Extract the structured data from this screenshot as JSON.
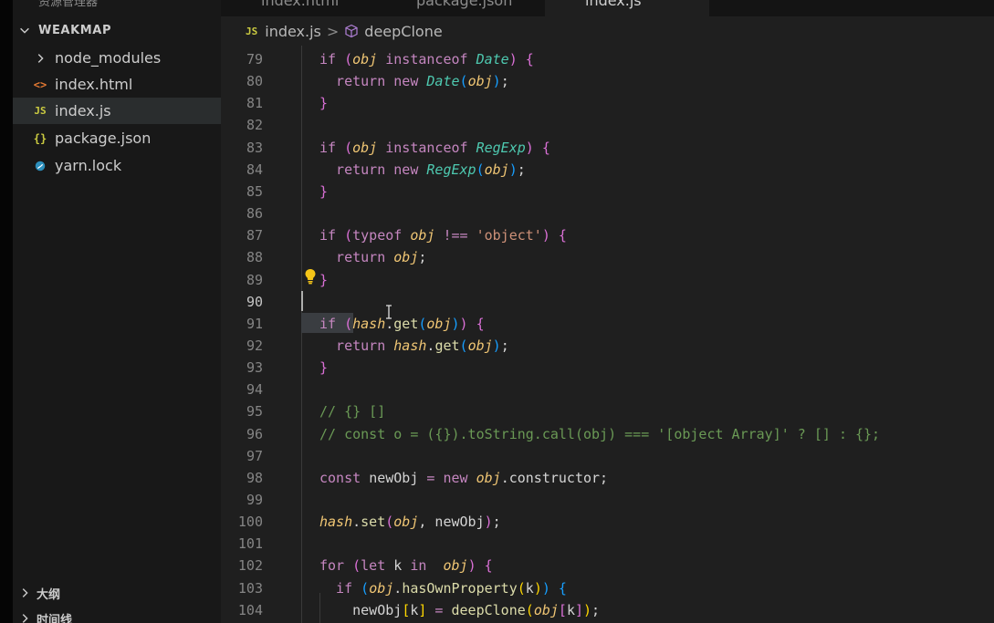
{
  "window": {
    "tabs": [
      {
        "label": "index.html",
        "active": false
      },
      {
        "label": "package.json",
        "active": false
      },
      {
        "label": "index.js",
        "active": true
      }
    ]
  },
  "sidebar": {
    "explorer_top_label": "资源管理器",
    "project_name": "WEAKMAP",
    "items": [
      {
        "label": "node_modules",
        "icon": "chevron-right-icon",
        "type": "folder"
      },
      {
        "label": "index.html",
        "icon": "html-file-icon",
        "type": "file"
      },
      {
        "label": "index.js",
        "icon": "js-file-icon",
        "type": "file",
        "active": true
      },
      {
        "label": "package.json",
        "icon": "json-file-icon",
        "type": "file"
      },
      {
        "label": "yarn.lock",
        "icon": "yarn-file-icon",
        "type": "file"
      }
    ],
    "bottom_sections": [
      {
        "label": "大纲"
      },
      {
        "label": "时间线"
      }
    ],
    "icon_glyphs": {
      "js": "JS",
      "html": "<>",
      "json": "{}"
    }
  },
  "breadcrumb": {
    "file_icon": "JS",
    "file": "index.js",
    "separator": ">",
    "symbol_icon": "cube-icon",
    "symbol": "deepClone"
  },
  "editor": {
    "language": "javascript",
    "current_line": 90,
    "line_numbers": [
      "79",
      "80",
      "81",
      "82",
      "83",
      "84",
      "85",
      "86",
      "87",
      "88",
      "89",
      "90",
      "91",
      "92",
      "93",
      "94",
      "95",
      "96",
      "97",
      "98",
      "99",
      "100",
      "101",
      "102",
      "103",
      "104"
    ],
    "lines": [
      [
        {
          "t": "if ",
          "c": "kw"
        },
        {
          "t": "(",
          "c": "b2"
        },
        {
          "t": "obj",
          "c": "var"
        },
        {
          "t": " instanceof ",
          "c": "kw"
        },
        {
          "t": "Date",
          "c": "cls"
        },
        {
          "t": ")",
          "c": "b2"
        },
        {
          "t": " {",
          "c": "b2"
        }
      ],
      [
        {
          "t": "  return ",
          "c": "kw"
        },
        {
          "t": "new ",
          "c": "kw"
        },
        {
          "t": "Date",
          "c": "cls"
        },
        {
          "t": "(",
          "c": "b3"
        },
        {
          "t": "obj",
          "c": "var"
        },
        {
          "t": ")",
          "c": "b3"
        },
        {
          "t": ";",
          "c": "plain"
        }
      ],
      [
        {
          "t": "}",
          "c": "b2"
        }
      ],
      [],
      [
        {
          "t": "if ",
          "c": "kw"
        },
        {
          "t": "(",
          "c": "b2"
        },
        {
          "t": "obj",
          "c": "var"
        },
        {
          "t": " instanceof ",
          "c": "kw"
        },
        {
          "t": "RegExp",
          "c": "cls"
        },
        {
          "t": ")",
          "c": "b2"
        },
        {
          "t": " {",
          "c": "b2"
        }
      ],
      [
        {
          "t": "  return ",
          "c": "kw"
        },
        {
          "t": "new ",
          "c": "kw"
        },
        {
          "t": "RegExp",
          "c": "cls"
        },
        {
          "t": "(",
          "c": "b3"
        },
        {
          "t": "obj",
          "c": "var"
        },
        {
          "t": ")",
          "c": "b3"
        },
        {
          "t": ";",
          "c": "plain"
        }
      ],
      [
        {
          "t": "}",
          "c": "b2"
        }
      ],
      [],
      [
        {
          "t": "if ",
          "c": "kw"
        },
        {
          "t": "(",
          "c": "b2"
        },
        {
          "t": "typeof ",
          "c": "kw"
        },
        {
          "t": "obj",
          "c": "var"
        },
        {
          "t": " !== ",
          "c": "op"
        },
        {
          "t": "'object'",
          "c": "str"
        },
        {
          "t": ")",
          "c": "b2"
        },
        {
          "t": " {",
          "c": "b2"
        }
      ],
      [
        {
          "t": "  return ",
          "c": "kw"
        },
        {
          "t": "obj",
          "c": "var"
        },
        {
          "t": ";",
          "c": "plain"
        }
      ],
      [
        {
          "t": "}",
          "c": "b2"
        }
      ],
      [],
      [
        {
          "t": "if ",
          "c": "kw"
        },
        {
          "t": "(",
          "c": "b2"
        },
        {
          "t": "hash",
          "c": "var"
        },
        {
          "t": ".",
          "c": "plain"
        },
        {
          "t": "get",
          "c": "fn"
        },
        {
          "t": "(",
          "c": "b3"
        },
        {
          "t": "obj",
          "c": "var"
        },
        {
          "t": ")",
          "c": "b3"
        },
        {
          "t": ")",
          "c": "b2"
        },
        {
          "t": " {",
          "c": "b2"
        }
      ],
      [
        {
          "t": "  return ",
          "c": "kw"
        },
        {
          "t": "hash",
          "c": "var"
        },
        {
          "t": ".",
          "c": "plain"
        },
        {
          "t": "get",
          "c": "fn"
        },
        {
          "t": "(",
          "c": "b3"
        },
        {
          "t": "obj",
          "c": "var"
        },
        {
          "t": ")",
          "c": "b3"
        },
        {
          "t": ";",
          "c": "plain"
        }
      ],
      [
        {
          "t": "}",
          "c": "b2"
        }
      ],
      [],
      [
        {
          "t": "// {} []",
          "c": "cmt"
        }
      ],
      [
        {
          "t": "// const o = ({}).toString.call(obj) === '[object Array]' ? [] : {};",
          "c": "cmt"
        }
      ],
      [],
      [
        {
          "t": "const ",
          "c": "kw"
        },
        {
          "t": "newObj ",
          "c": "plain"
        },
        {
          "t": "= ",
          "c": "op"
        },
        {
          "t": "new ",
          "c": "kw"
        },
        {
          "t": "obj",
          "c": "var"
        },
        {
          "t": ".constructor;",
          "c": "plain"
        }
      ],
      [],
      [
        {
          "t": "hash",
          "c": "var"
        },
        {
          "t": ".",
          "c": "plain"
        },
        {
          "t": "set",
          "c": "fn"
        },
        {
          "t": "(",
          "c": "b2"
        },
        {
          "t": "obj",
          "c": "var"
        },
        {
          "t": ", newObj",
          "c": "plain"
        },
        {
          "t": ")",
          "c": "b2"
        },
        {
          "t": ";",
          "c": "plain"
        }
      ],
      [],
      [
        {
          "t": "for ",
          "c": "kw"
        },
        {
          "t": "(",
          "c": "b2"
        },
        {
          "t": "let ",
          "c": "kw"
        },
        {
          "t": "k ",
          "c": "plain"
        },
        {
          "t": "in ",
          "c": "kw"
        },
        {
          "t": " obj",
          "c": "var"
        },
        {
          "t": ")",
          "c": "b2"
        },
        {
          "t": " {",
          "c": "b2"
        }
      ],
      [
        {
          "t": "  if ",
          "c": "kw"
        },
        {
          "t": "(",
          "c": "b3"
        },
        {
          "t": "obj",
          "c": "var"
        },
        {
          "t": ".",
          "c": "plain"
        },
        {
          "t": "hasOwnProperty",
          "c": "fn"
        },
        {
          "t": "(",
          "c": "b1"
        },
        {
          "t": "k",
          "c": "plain"
        },
        {
          "t": ")",
          "c": "b1"
        },
        {
          "t": ")",
          "c": "b3"
        },
        {
          "t": " {",
          "c": "b3"
        }
      ],
      [
        {
          "t": "    newObj",
          "c": "plain"
        },
        {
          "t": "[",
          "c": "b1"
        },
        {
          "t": "k",
          "c": "plain"
        },
        {
          "t": "]",
          "c": "b1"
        },
        {
          "t": " = ",
          "c": "op"
        },
        {
          "t": "deepClone",
          "c": "fn"
        },
        {
          "t": "(",
          "c": "b1"
        },
        {
          "t": "obj",
          "c": "var"
        },
        {
          "t": "[",
          "c": "b2"
        },
        {
          "t": "k",
          "c": "plain"
        },
        {
          "t": "]",
          "c": "b2"
        },
        {
          "t": ")",
          "c": "b1"
        },
        {
          "t": ";",
          "c": "plain"
        }
      ]
    ]
  },
  "colors": {
    "editor_bg": "#1f1f1f",
    "sidebar_bg": "#181818",
    "keyword": "#c586c0",
    "variable": "#f0c674",
    "class": "#4ec9b0",
    "function": "#dcdcaa",
    "string": "#ce9178",
    "comment": "#6a9955"
  }
}
